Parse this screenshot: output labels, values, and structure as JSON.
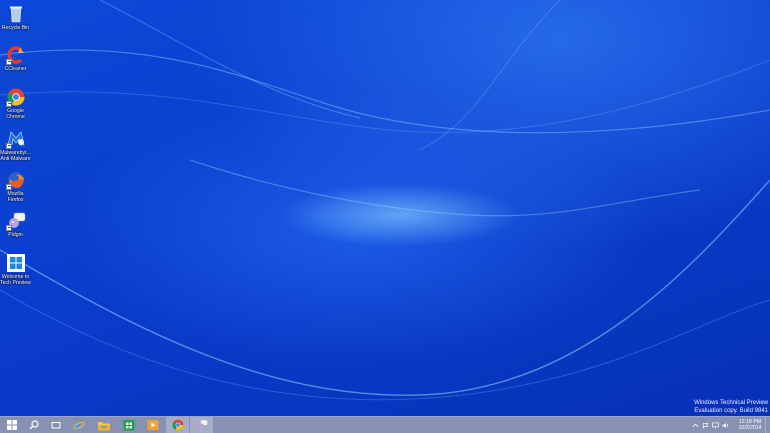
{
  "desktop": {
    "icons": [
      {
        "label": "Recycle Bin",
        "icon": "recycle-bin-icon",
        "shortcut": false
      },
      {
        "label": "CCleaner",
        "icon": "ccleaner-icon",
        "shortcut": true
      },
      {
        "label": "Google\nChrome",
        "icon": "chrome-icon",
        "shortcut": true
      },
      {
        "label": "Malwarebyt...\nAnti-Malware",
        "icon": "malwarebytes-icon",
        "shortcut": true
      },
      {
        "label": "Mozilla\nFirefox",
        "icon": "firefox-icon",
        "shortcut": true
      },
      {
        "label": "Pidgin",
        "icon": "pidgin-icon",
        "shortcut": true
      },
      {
        "label": "Welcome to\nTech Preview",
        "icon": "windows-welcome-icon",
        "shortcut": false
      }
    ]
  },
  "watermark": {
    "line1": "Windows Technical Preview",
    "line2": "Evaluation copy. Build 9841"
  },
  "taskbar": {
    "buttons": [
      "start-icon",
      "search-icon",
      "task-view-icon",
      "internet-explorer-icon",
      "file-explorer-icon",
      "store-icon",
      "media-player-icon",
      "chrome-icon",
      "pidgin-icon"
    ],
    "tray": [
      "show-hidden-icons-chevron-icon",
      "action-center-flag-icon",
      "network-icon",
      "volume-icon"
    ],
    "clock": {
      "time": "12:18 PM",
      "date": "10/2/2014"
    }
  },
  "colors": {
    "wallpaper": "#0a3fd0",
    "taskbar": "#8792b3"
  }
}
